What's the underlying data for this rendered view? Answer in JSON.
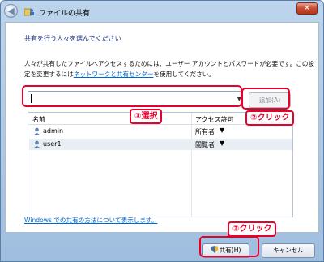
{
  "window": {
    "title": "ファイルの共有",
    "back_glyph": "◀",
    "close_glyph": "✕"
  },
  "main": {
    "heading": "共有を行う人々を選んでください",
    "description_part1": "人々が共有したファイルへアクセスするためには、ユーザー アカウントとパスワードが必要です。この設定を変更するには",
    "description_link": "ネットワークと共有センター",
    "description_part2": "を使用してください。",
    "combo_value": "",
    "combo_arrow": "▼",
    "add_button": "追加(A)"
  },
  "table": {
    "headers": {
      "name": "名前",
      "access": "アクセス許可"
    },
    "rows": [
      {
        "name": "admin",
        "permission": "所有者",
        "arrow": "▼"
      },
      {
        "name": "user1",
        "permission": "閲覧者",
        "arrow": "▼"
      }
    ]
  },
  "help_link": "Windows での共有の方法について表示します。",
  "buttons": {
    "share": "共有(H)",
    "cancel": "キャンセル"
  },
  "annotations": {
    "step1": "①選択",
    "step2": "②クリック",
    "step3": "③クリック"
  },
  "colors": {
    "annotation_red": "#e8002b",
    "link_blue": "#0066cc",
    "heading_blue": "#1e3287"
  }
}
